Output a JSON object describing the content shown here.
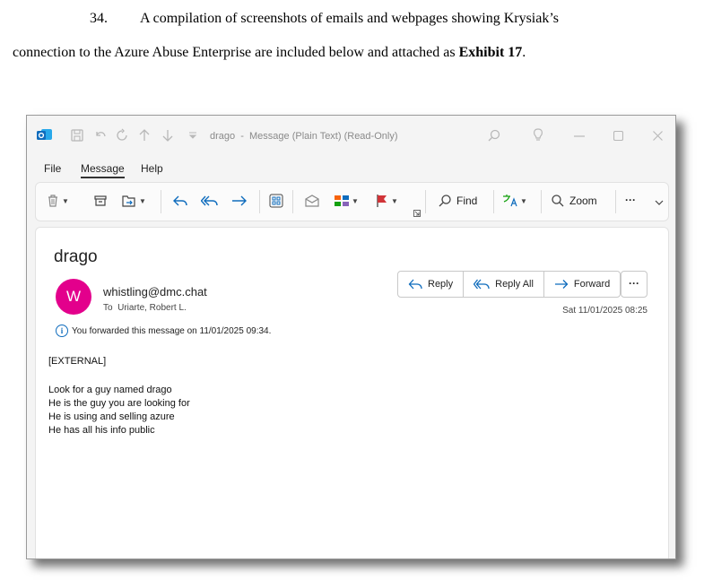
{
  "document": {
    "para_number": "34.",
    "line1_text": "A compilation of screenshots of emails and webpages showing Krysiak’s",
    "line2_text": "connection to the Azure Abuse Enterprise are included below and attached as ",
    "exhibit_label": "Exhibit 17",
    "line2_end": "."
  },
  "window": {
    "title": "drago  -  Message (Plain Text) (Read-Only)",
    "icons": [
      "outlook-icon",
      "save-icon",
      "undo-icon",
      "redo-icon",
      "up-icon",
      "down-icon",
      "customize-icon",
      "search-icon",
      "lightbulb-icon",
      "minimize-icon",
      "maximize-icon",
      "close-icon"
    ]
  },
  "menu": {
    "file": "File",
    "message": "Message",
    "help": "Help"
  },
  "ribbon": {
    "find_label": "Find",
    "zoom_label": "Zoom",
    "more_label": "···"
  },
  "message": {
    "subject": "drago",
    "avatar_initial": "W",
    "sender": "whistling@dmc.chat",
    "to_prefix": "To",
    "to_name": "Uriarte, Robert L.",
    "forwarded_note": "You forwarded this message on 11/01/2025 09:34.",
    "actions": {
      "reply": "Reply",
      "reply_all": "Reply All",
      "forward": "Forward",
      "more": "···"
    },
    "date": "Sat 11/01/2025 08:25",
    "body": {
      "external_tag": "[EXTERNAL]",
      "lines": [
        "Look for a guy named drago",
        "He is the guy you are looking for",
        "He is using and selling azure",
        "He has all his info public"
      ]
    }
  },
  "colors": {
    "accent": "#0f6cbd",
    "avatar": "#e3008c",
    "flag": "#d13438"
  }
}
